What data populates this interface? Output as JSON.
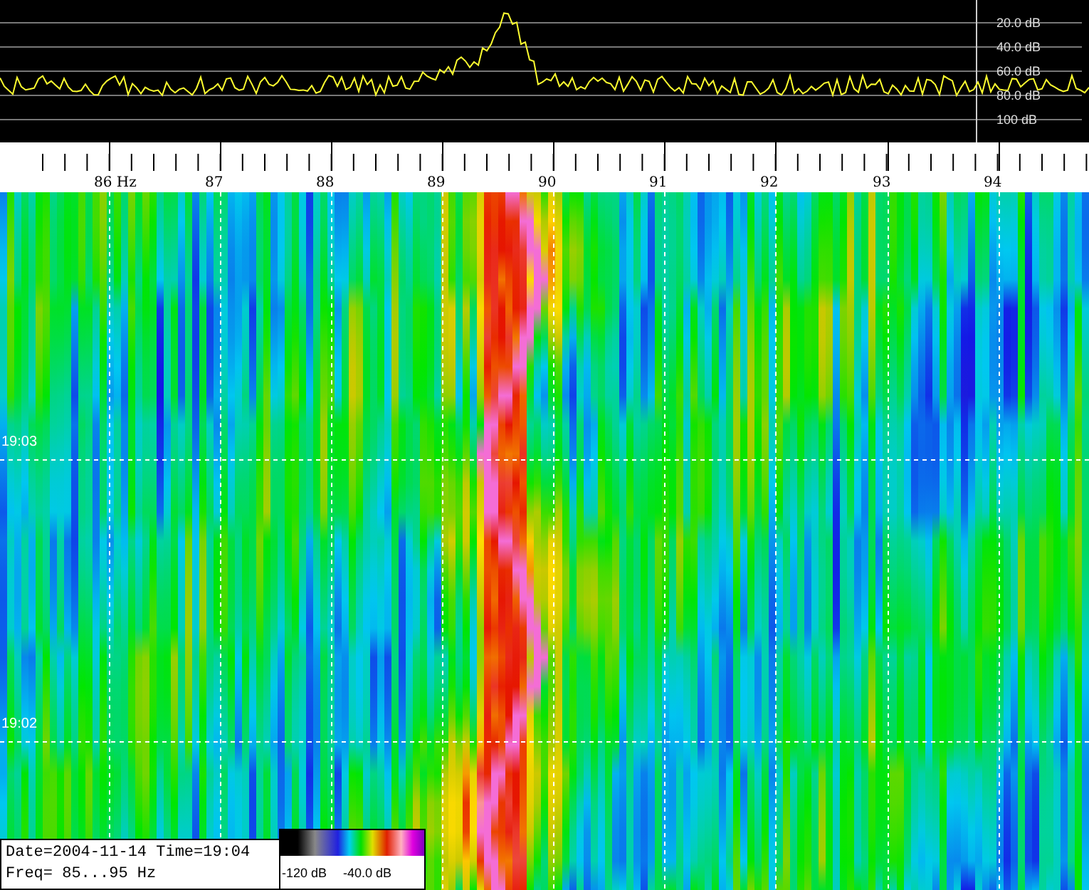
{
  "spectrum": {
    "db_labels": [
      "20.0 dB",
      "40.0 dB",
      "60.0 dB",
      "80.0 dB",
      "100 dB"
    ]
  },
  "frequency_axis": {
    "labels": [
      "86 Hz",
      "87",
      "88",
      "89",
      "90",
      "91",
      "92",
      "93",
      "94"
    ]
  },
  "waterfall": {
    "time_labels": [
      "19:03",
      "19:02"
    ]
  },
  "info": {
    "lines": [
      "Date=2004-11-14 Time=19:04",
      "Freq= 85...95 Hz"
    ]
  },
  "colorbar": {
    "labels": [
      "-120 dB",
      "-40.0 dB"
    ]
  }
}
